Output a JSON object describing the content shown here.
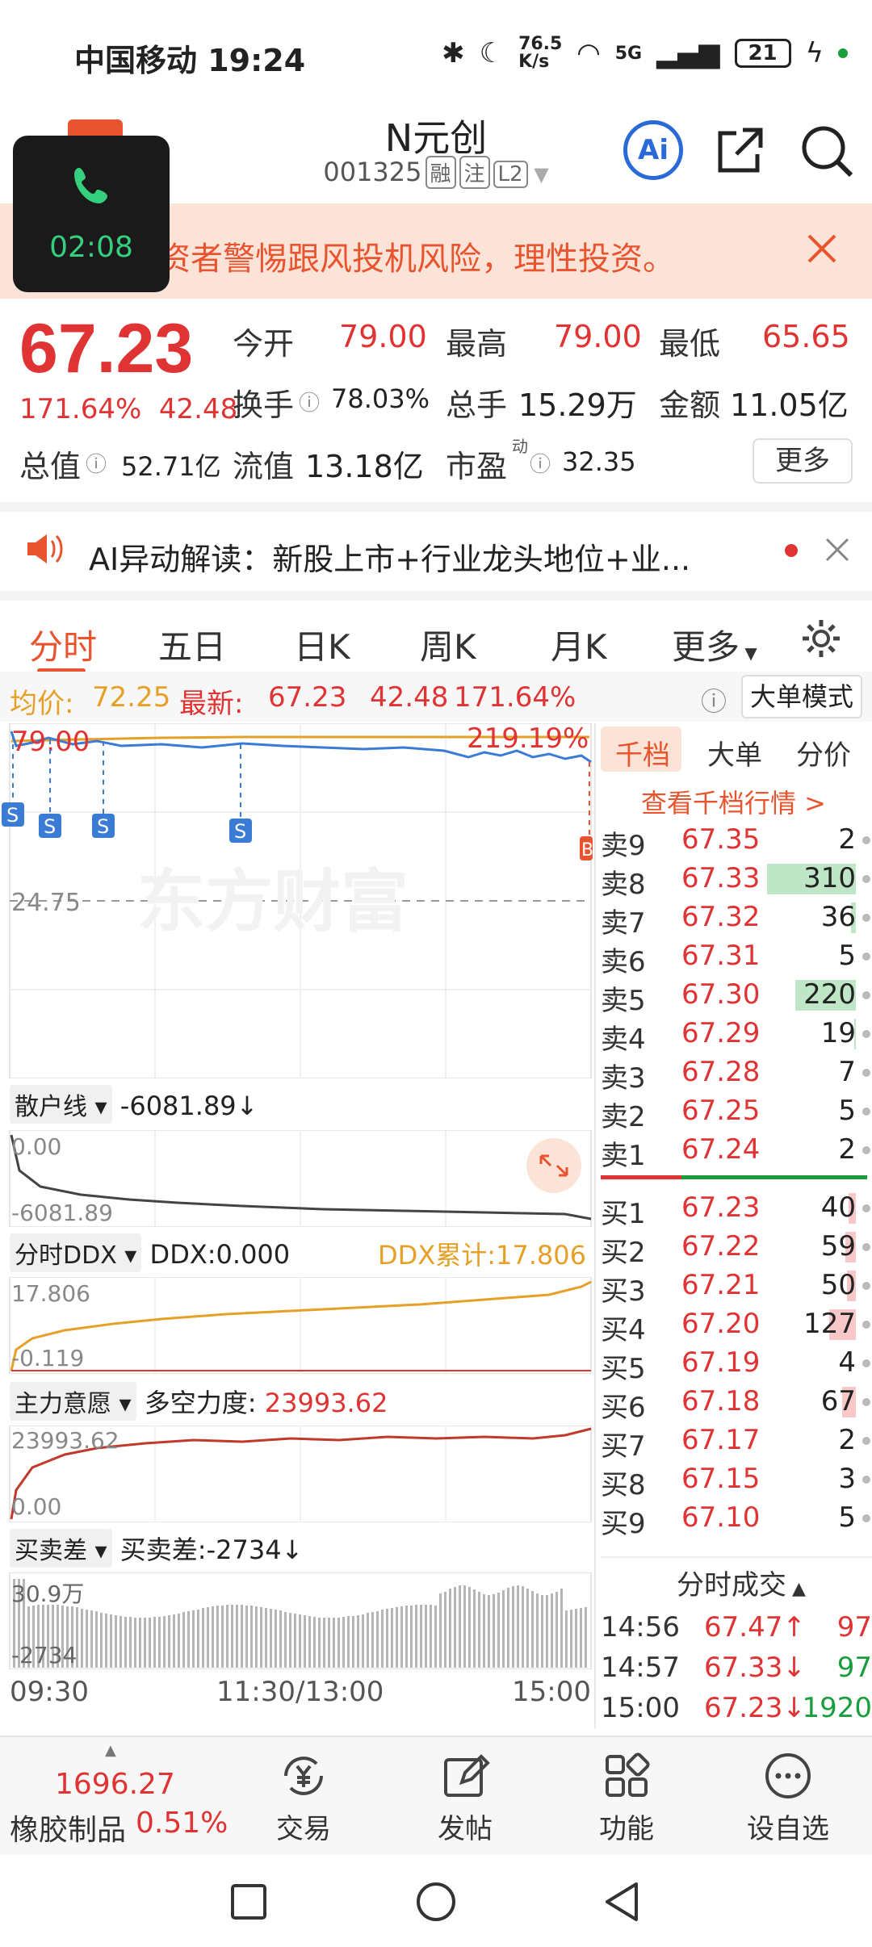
{
  "status": {
    "carrier_time": "中国移动 19:24",
    "net_speed": "76.5 K/s",
    "signal_label": "5G",
    "battery": "21"
  },
  "header": {
    "title": "N元创",
    "code": "001325",
    "tags": [
      "融",
      "注",
      "L2"
    ],
    "ai_label": "Ai"
  },
  "call": {
    "time": "02:08"
  },
  "banner": {
    "text": "资者警惕跟风投机风险，理性投资。"
  },
  "quote": {
    "price": "67.23",
    "change_pct": "171.64%",
    "change_amt": "42.48",
    "open_label": "今开",
    "open": "79.00",
    "high_label": "最高",
    "high": "79.00",
    "low_label": "最低",
    "low": "65.65",
    "turnover_label": "换手",
    "turnover": "78.03%",
    "volume_label": "总手",
    "volume": "15.29万",
    "amount_label": "金额",
    "amount": "11.05亿",
    "mktcap_label": "总值",
    "mktcap": "52.71亿",
    "float_label": "流值",
    "float": "13.18亿",
    "pe_label": "市盈",
    "pe_sup": "动",
    "pe": "32.35",
    "more_label": "更多"
  },
  "ainews": {
    "text": "AI异动解读：新股上市+行业龙头地位+业..."
  },
  "tabs": [
    "分时",
    "五日",
    "日K",
    "周K",
    "月K",
    "更多"
  ],
  "avg": {
    "avg_label": "均价:",
    "avg": "72.25",
    "latest_label": "最新:",
    "latest": "67.23",
    "chg": "42.48",
    "pct": "171.64%",
    "big_mode": "大单模式"
  },
  "chart": {
    "price_top": "79.00",
    "pct_top": "219.19%",
    "ref_price": "24.75",
    "watermark": "东方财富",
    "s_marker": "S",
    "b_marker": "B",
    "retail_label": "散户线",
    "retail_value": "-6081.89↓",
    "retail_top": "0.00",
    "retail_bottom": "-6081.89",
    "ddx_label": "分时DDX",
    "ddx_value": "DDX:0.000",
    "ddx_sum": "DDX累计:17.806",
    "ddx_top": "17.806",
    "ddx_bottom": "-0.119",
    "main_label": "主力意愿",
    "main_value_label": "多空力度:",
    "main_value": "23993.62",
    "main_top": "23993.62",
    "main_bottom": "0.00",
    "bs_label": "买卖差",
    "bs_value": "买卖差:-2734↓",
    "bs_top": "30.9万",
    "bs_bottom": "-2734",
    "time_start": "09:30",
    "time_mid": "11:30/13:00",
    "time_end": "15:00"
  },
  "book": {
    "tabs": [
      "千档",
      "大单",
      "分价"
    ],
    "view_link": "查看千档行情 >",
    "asks": [
      {
        "label": "卖9",
        "price": "67.35",
        "vol": "2",
        "bar": 0
      },
      {
        "label": "卖8",
        "price": "67.33",
        "vol": "310",
        "bar": 1.0
      },
      {
        "label": "卖7",
        "price": "67.32",
        "vol": "36",
        "bar": 0.05
      },
      {
        "label": "卖6",
        "price": "67.31",
        "vol": "5",
        "bar": 0
      },
      {
        "label": "卖5",
        "price": "67.30",
        "vol": "220",
        "bar": 0.68
      },
      {
        "label": "卖4",
        "price": "67.29",
        "vol": "19",
        "bar": 0.02
      },
      {
        "label": "卖3",
        "price": "67.28",
        "vol": "7",
        "bar": 0
      },
      {
        "label": "卖2",
        "price": "67.25",
        "vol": "5",
        "bar": 0
      },
      {
        "label": "卖1",
        "price": "67.24",
        "vol": "2",
        "bar": 0
      }
    ],
    "bids": [
      {
        "label": "买1",
        "price": "67.23",
        "vol": "40",
        "bar": 0.08
      },
      {
        "label": "买2",
        "price": "67.22",
        "vol": "59",
        "bar": 0.12
      },
      {
        "label": "买3",
        "price": "67.21",
        "vol": "50",
        "bar": 0.1
      },
      {
        "label": "买4",
        "price": "67.20",
        "vol": "127",
        "bar": 0.3
      },
      {
        "label": "买5",
        "price": "67.19",
        "vol": "4",
        "bar": 0
      },
      {
        "label": "买6",
        "price": "67.18",
        "vol": "67",
        "bar": 0.15
      },
      {
        "label": "买7",
        "price": "67.17",
        "vol": "2",
        "bar": 0
      },
      {
        "label": "买8",
        "price": "67.15",
        "vol": "3",
        "bar": 0
      },
      {
        "label": "买9",
        "price": "67.10",
        "vol": "5",
        "bar": 0
      }
    ],
    "trades_title": "分时成交",
    "trades": [
      {
        "time": "14:56",
        "price": "67.47↑",
        "vol": "97",
        "dir": "up"
      },
      {
        "time": "14:57",
        "price": "67.33↓",
        "vol": "97",
        "dir": "down"
      },
      {
        "time": "15:00",
        "price": "67.23↓",
        "vol": "1920",
        "dir": "down"
      }
    ]
  },
  "bottomnav": {
    "index_value": "1696.27",
    "index_name": "橡胶制品",
    "index_pct": "0.51%",
    "items": [
      "交易",
      "发帖",
      "功能",
      "设自选"
    ]
  },
  "colors": {
    "up": "#e03333",
    "down": "#1a9e3c",
    "accent": "#e8542e",
    "avg_line": "#e6a028",
    "price_line": "#3a7bd5"
  }
}
